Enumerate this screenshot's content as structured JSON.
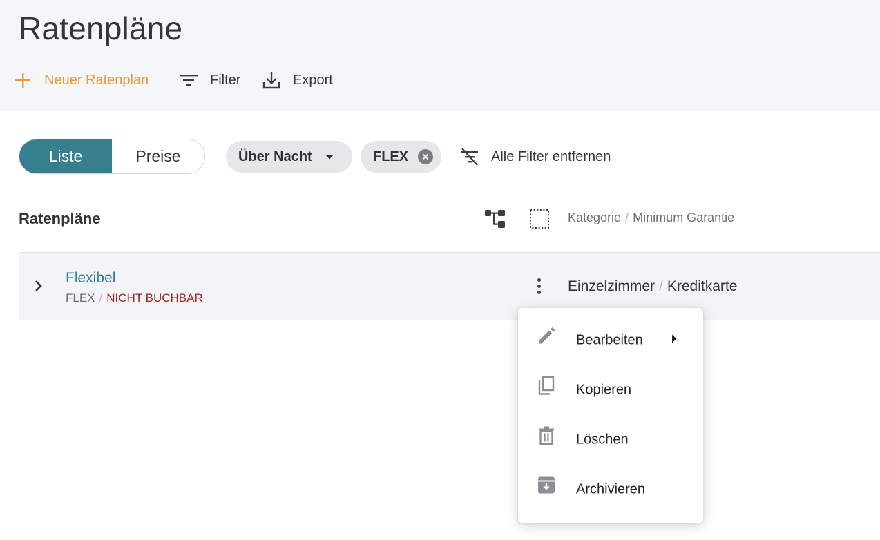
{
  "header": {
    "title": "Ratenpläne",
    "new_label": "Neuer Ratenplan",
    "filter_label": "Filter",
    "export_label": "Export"
  },
  "view_toggle": {
    "options": [
      "Liste",
      "Preise"
    ],
    "selected": "Liste"
  },
  "filters": {
    "chips": [
      {
        "label": "Über Nacht",
        "type": "dropdown"
      },
      {
        "label": "FLEX",
        "type": "removable"
      }
    ],
    "clear_label": "Alle Filter entfernen"
  },
  "list": {
    "title": "Ratenpläne",
    "column_header": {
      "col1": "Kategorie",
      "col2": "Minimum Garantie"
    },
    "rows": [
      {
        "name": "Flexibel",
        "code": "FLEX",
        "status": "NICHT BUCHBAR",
        "category": "Einzelzimmer",
        "guarantee": "Kreditkarte"
      }
    ]
  },
  "context_menu": {
    "items": [
      {
        "label": "Bearbeiten",
        "icon": "pencil-icon",
        "has_submenu": true
      },
      {
        "label": "Kopieren",
        "icon": "copy-icon",
        "has_submenu": false
      },
      {
        "label": "Löschen",
        "icon": "trash-icon",
        "has_submenu": false
      },
      {
        "label": "Archivieren",
        "icon": "archive-icon",
        "has_submenu": false
      }
    ]
  },
  "colors": {
    "accent": "#377e8e",
    "primary_action": "#e59a3c",
    "warning": "#a3231d",
    "header_bg": "#f5f6fa"
  }
}
